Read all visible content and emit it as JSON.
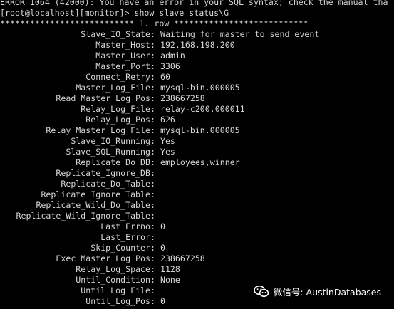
{
  "terminal": {
    "error_line": "ERROR 1064 (42000): You have an error in your SQL syntax; check the manual tha",
    "prompt_line": "[root@localhost][monitor]> show slave status\\G",
    "row_header": "*************************** 1. row ***************************",
    "fields": [
      {
        "name": "Slave_IO_State",
        "value": "Waiting for master to send event"
      },
      {
        "name": "Master_Host",
        "value": "192.168.198.200"
      },
      {
        "name": "Master_User",
        "value": "admin"
      },
      {
        "name": "Master_Port",
        "value": "3306"
      },
      {
        "name": "Connect_Retry",
        "value": "60"
      },
      {
        "name": "Master_Log_File",
        "value": "mysql-bin.000005"
      },
      {
        "name": "Read_Master_Log_Pos",
        "value": "238667258"
      },
      {
        "name": "Relay_Log_File",
        "value": "relay-c200.000011"
      },
      {
        "name": "Relay_Log_Pos",
        "value": "626"
      },
      {
        "name": "Relay_Master_Log_File",
        "value": "mysql-bin.000005"
      },
      {
        "name": "Slave_IO_Running",
        "value": "Yes"
      },
      {
        "name": "Slave_SQL_Running",
        "value": "Yes"
      },
      {
        "name": "Replicate_Do_DB",
        "value": "employees,winner"
      },
      {
        "name": "Replicate_Ignore_DB",
        "value": ""
      },
      {
        "name": "Replicate_Do_Table",
        "value": ""
      },
      {
        "name": "Replicate_Ignore_Table",
        "value": ""
      },
      {
        "name": "Replicate_Wild_Do_Table",
        "value": ""
      },
      {
        "name": "Replicate_Wild_Ignore_Table",
        "value": ""
      },
      {
        "name": "Last_Errno",
        "value": "0"
      },
      {
        "name": "Last_Error",
        "value": ""
      },
      {
        "name": "Skip_Counter",
        "value": "0"
      },
      {
        "name": "Exec_Master_Log_Pos",
        "value": "238667258"
      },
      {
        "name": "Relay_Log_Space",
        "value": "1128"
      },
      {
        "name": "Until_Condition",
        "value": "None"
      },
      {
        "name": "Until_Log_File",
        "value": ""
      },
      {
        "name": "Until_Log_Pos",
        "value": "0"
      }
    ],
    "separator": ": "
  },
  "watermark": {
    "icon": "wechat-icon",
    "text": "微信号: AustinDatabases"
  },
  "colors": {
    "background": "#000000",
    "foreground": "#d6d6d6",
    "watermark_text": "#ffffff"
  }
}
